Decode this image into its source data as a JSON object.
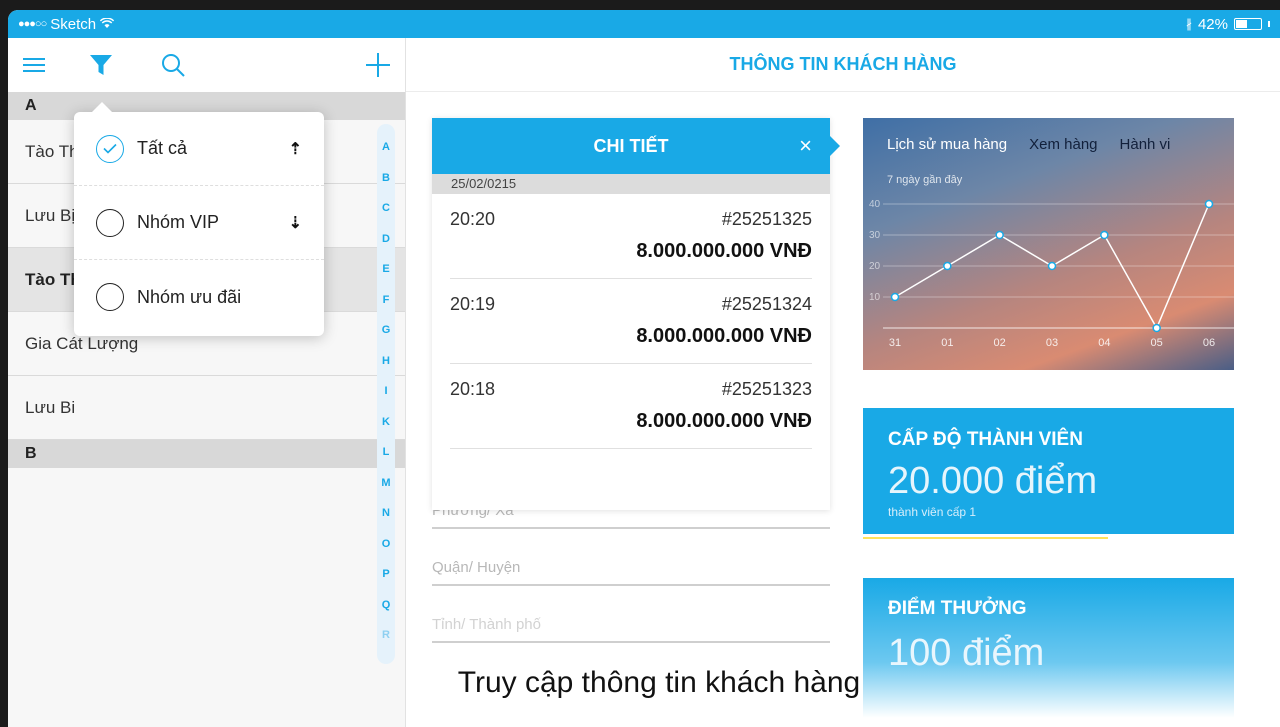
{
  "status_bar": {
    "carrier": "Sketch",
    "battery": "42%"
  },
  "toolbar": {
    "menu_icon": "menu-icon",
    "filter_icon": "filter-icon",
    "search_icon": "search-icon",
    "add_icon": "plus-icon"
  },
  "header": {
    "title": "THÔNG TIN KHÁCH HÀNG"
  },
  "contacts": {
    "section_a": "A",
    "items": [
      {
        "name": "Tào Tháo"
      },
      {
        "name": "Lưu Bị"
      },
      {
        "name": "Tào Tháo"
      },
      {
        "name": "Gia Cát Lượng"
      },
      {
        "name": "Lưu Bi"
      }
    ],
    "section_b": "B",
    "index": [
      "A",
      "B",
      "C",
      "D",
      "E",
      "F",
      "G",
      "H",
      "I",
      "K",
      "L",
      "M",
      "N",
      "O",
      "P",
      "Q",
      "R"
    ]
  },
  "filter": {
    "options": [
      {
        "label": "Tất cả",
        "checked": true
      },
      {
        "label": "Nhóm VIP",
        "checked": false
      },
      {
        "label": "Nhóm ưu đãi",
        "checked": false
      }
    ]
  },
  "detail": {
    "title": "CHI TIẾT",
    "close": "×",
    "date": "25/02/0215",
    "transactions": [
      {
        "time": "20:20",
        "code": "#25251325",
        "amount": "8.000.000.000 VNĐ"
      },
      {
        "time": "20:19",
        "code": "#25251324",
        "amount": "8.000.000.000 VNĐ"
      },
      {
        "time": "20:18",
        "code": "#25251323",
        "amount": "8.000.000.000 VNĐ"
      }
    ],
    "fields": {
      "ward": "Phường/ Xã",
      "district": "Quận/ Huyện",
      "city": "Tỉnh/ Thành phố"
    }
  },
  "history": {
    "tabs": [
      "Lịch sử mua hàng",
      "Xem hàng",
      "Hành vi"
    ],
    "subtitle": "7 ngày gần đây"
  },
  "chart_data": {
    "type": "line",
    "categories": [
      "31",
      "01",
      "02",
      "03",
      "04",
      "05",
      "06"
    ],
    "values": [
      10,
      20,
      30,
      20,
      30,
      0,
      40
    ],
    "yticks": [
      10,
      20,
      30,
      40
    ],
    "ylim": [
      0,
      40
    ],
    "grid": true,
    "title": "",
    "xlabel": "",
    "ylabel": ""
  },
  "level": {
    "title": "CẤP ĐỘ THÀNH VIÊN",
    "points": "20.000 điểm",
    "sub": "thành viên cấp 1",
    "progress": 0.66
  },
  "reward": {
    "title": "ĐIỂM THƯỞNG",
    "points": "100 điểm"
  },
  "caption": "Truy cập thông tin khách hàng",
  "colors": {
    "accent": "#19a9e6",
    "progress": "#ffe25a"
  }
}
